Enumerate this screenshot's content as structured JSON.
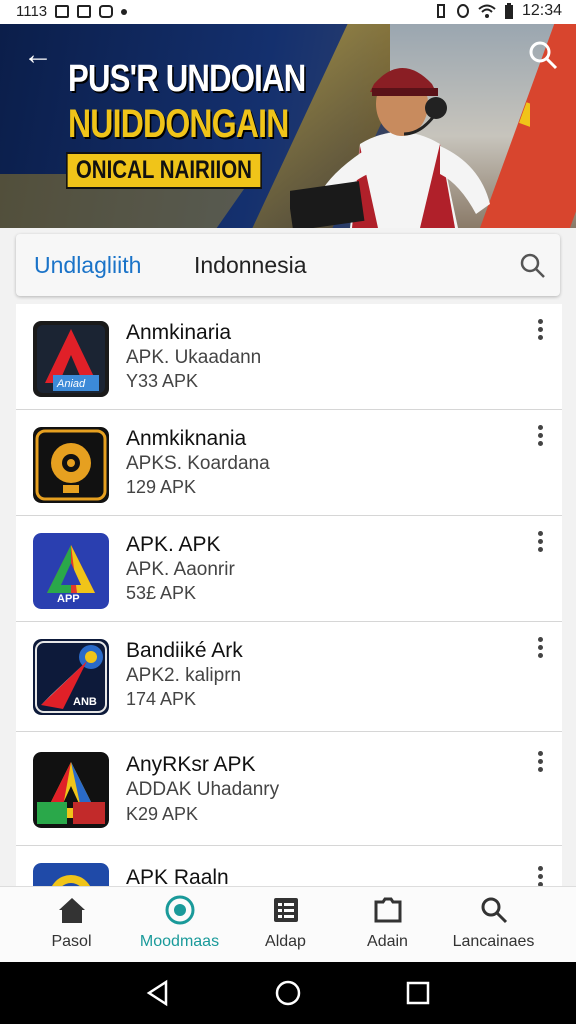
{
  "status_bar": {
    "left_text": "1113",
    "time": "12:34"
  },
  "banner": {
    "title_line1": "PUS'R UNDOIAN",
    "title_line2": "NUIDDONGAIN",
    "tagline": "ONICAL NAIRIION",
    "colors": {
      "title1": "#ffffff",
      "title2": "#f0c419",
      "tag_bg": "#f0c419"
    }
  },
  "search": {
    "brand": "Undlagliith",
    "query": "Indonnesia",
    "brand_color": "#1a73c8"
  },
  "apps": [
    {
      "name": "Anmkinaria",
      "subtitle": "APK. Ukaadann",
      "size": "Y33 APK",
      "icon": "red-a-icon",
      "icon_label": "Aniad"
    },
    {
      "name": "Anmkiknania",
      "subtitle": "APKS. Koardana",
      "size": "129 APK",
      "icon": "gear-badge-icon",
      "icon_label": ""
    },
    {
      "name": "APK. APK",
      "subtitle": "APK. Aaonrir",
      "size": "53£ APK",
      "icon": "prism-a-icon",
      "icon_label": "APP"
    },
    {
      "name": "Bandiiké Ark",
      "subtitle": "APK2. kaliprn",
      "size": "174 APK",
      "icon": "rocket-icon",
      "icon_label": "ANB"
    },
    {
      "name": "AnyRKsr APK",
      "subtitle": "ADDAK Uhadanry",
      "size": "K29 APK",
      "icon": "colorful-a-icon",
      "icon_label": ""
    },
    {
      "name": "APK Raaln",
      "subtitle": "",
      "size": "",
      "icon": "globe-icon",
      "icon_label": ""
    }
  ],
  "bottom_nav": [
    {
      "label": "Pasol",
      "icon": "home-icon",
      "active": false
    },
    {
      "label": "Moodmaas",
      "icon": "discover-icon",
      "active": true
    },
    {
      "label": "Aldap",
      "icon": "list-icon",
      "active": false
    },
    {
      "label": "Adain",
      "icon": "folder-icon",
      "active": false
    },
    {
      "label": "Lancainaes",
      "icon": "search-icon",
      "active": false
    }
  ],
  "system_nav": [
    "back-icon",
    "home-circle-icon",
    "recents-icon"
  ]
}
